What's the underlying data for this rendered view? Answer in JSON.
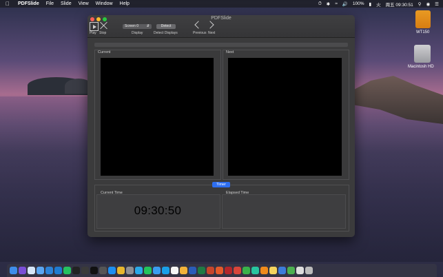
{
  "menubar": {
    "app_name": "PDFSlide",
    "menus": [
      "File",
      "Slide",
      "View",
      "Window",
      "Help"
    ],
    "battery": "100%",
    "status_text": "火",
    "clock": "周五 09:30:51"
  },
  "desktop": {
    "usb_label": "WT150",
    "hd_label": "Macintosh HD"
  },
  "window": {
    "title": "PDFSlide",
    "toolbar": {
      "play_label": "Play",
      "stop_label": "Stop",
      "display_value": "Screen 0",
      "display_label": "Display",
      "detect_button": "Detect",
      "detect_label": "Detect Displays",
      "previous_label": "Previous",
      "next_label": "Next"
    },
    "panels": {
      "current_label": "Current",
      "next_label": "Next"
    },
    "timer": {
      "tab_label": "Timer",
      "current_time_label": "Current Time",
      "current_time_value": "09:30:50",
      "elapsed_time_label": "Elapsed Time"
    }
  },
  "colors": {
    "accent_blue": "#2d6ef0",
    "close": "#fe5f57",
    "minimize": "#febc2e",
    "maximize": "#28c840"
  },
  "dock": {
    "icons": [
      "finder-icon",
      "siri-icon",
      "safari-icon",
      "mail-icon",
      "xcode-icon",
      "vscode-icon",
      "wechat-icon",
      "terminal-icon",
      "app-icon",
      "activity-monitor-icon",
      "screenshot-icon",
      "appstore-icon",
      "chrome-icon",
      "system-preferences-icon",
      "qq-icon",
      "wechat2-icon",
      "qq-browser-icon",
      "skype-icon",
      "calendar-icon",
      "photos-icon",
      "word-icon",
      "excel-icon",
      "powerpoint-icon",
      "office-icon",
      "filezilla-icon",
      "xmind-icon",
      "cloud-icon",
      "pycharm-icon",
      "vlc-icon",
      "notes-icon",
      "downloads-icon",
      "android-icon",
      "folder-icon",
      "trash-icon"
    ]
  }
}
